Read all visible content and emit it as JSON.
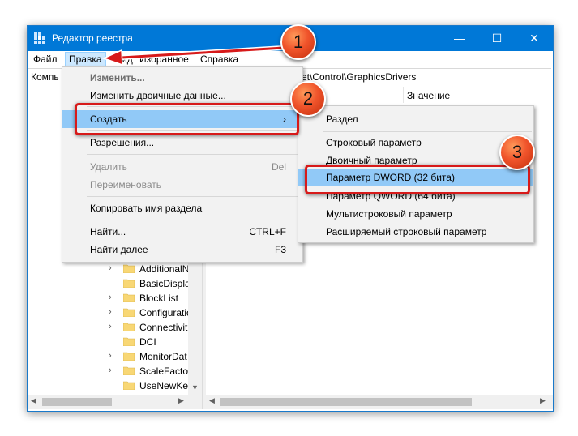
{
  "window": {
    "title": "Редактор реестра",
    "controls": {
      "minimize": "—",
      "maximize": "☐",
      "close": "✕"
    }
  },
  "menubar": [
    "Файл",
    "Правка",
    "Вид",
    "Избранное",
    "Справка"
  ],
  "address": {
    "left_visible": "Компь",
    "tail_visible": "Set\\Control\\GraphicsDrivers"
  },
  "value_pane": {
    "column_value": "Значение"
  },
  "tree": {
    "items": [
      "AdditionalN",
      "BasicDispla",
      "BlockList",
      "Configuratio",
      "Connectivit",
      "DCI",
      "MonitorDat",
      "ScaleFactor",
      "UseNewKey"
    ],
    "expandable": [
      true,
      false,
      true,
      true,
      true,
      false,
      true,
      true,
      false
    ]
  },
  "edit_menu": {
    "items": [
      {
        "label": "Изменить...",
        "shortcut": "",
        "state": "bold-dim"
      },
      {
        "label": "Изменить двоичные данные...",
        "shortcut": "",
        "state": "normal"
      },
      {
        "label": "Создать",
        "shortcut": "›",
        "state": "highlight"
      },
      {
        "label": "Разрешения...",
        "shortcut": "",
        "state": "normal"
      },
      {
        "label": "Удалить",
        "shortcut": "Del",
        "state": "disabled"
      },
      {
        "label": "Переименовать",
        "shortcut": "",
        "state": "disabled"
      },
      {
        "label": "Копировать имя раздела",
        "shortcut": "",
        "state": "normal"
      },
      {
        "label": "Найти...",
        "shortcut": "CTRL+F",
        "state": "normal"
      },
      {
        "label": "Найти далее",
        "shortcut": "F3",
        "state": "normal"
      }
    ]
  },
  "create_submenu": {
    "items": [
      {
        "label": "Раздел",
        "state": "normal"
      },
      {
        "label": "Строковый параметр",
        "state": "normal"
      },
      {
        "label": "Двоичный параметр",
        "state": "normal"
      },
      {
        "label": "Параметр DWORD (32 бита)",
        "state": "highlight"
      },
      {
        "label": "Параметр QWORD (64 бита)",
        "state": "normal"
      },
      {
        "label": "Мультистроковый параметр",
        "state": "normal"
      },
      {
        "label": "Расширяемый строковый параметр",
        "state": "normal"
      }
    ]
  },
  "callouts": [
    "1",
    "2",
    "3"
  ],
  "colors": {
    "titlebar": "#0078d7",
    "highlight": "#91c9f7",
    "callout_red": "#d71a1a",
    "badge_orange": "#f0542b"
  }
}
